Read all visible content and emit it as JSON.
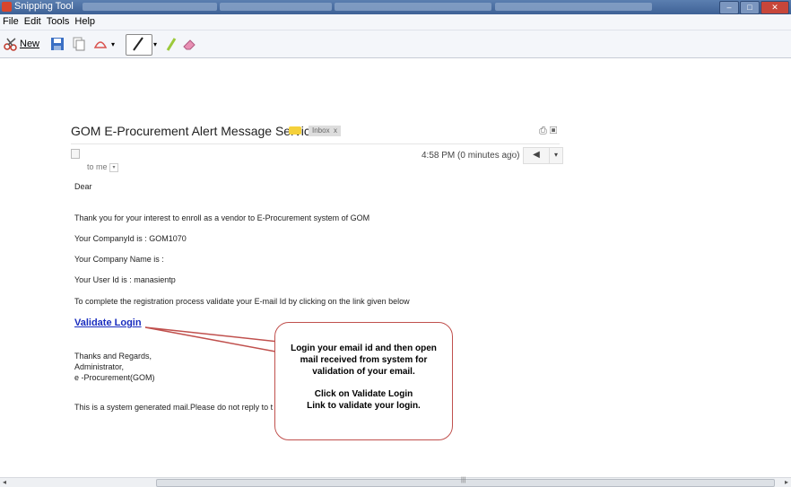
{
  "window": {
    "title": "Snipping Tool"
  },
  "menu": [
    "File",
    "Edit",
    "Tools",
    "Help"
  ],
  "toolbar": {
    "new_label": "New"
  },
  "email": {
    "subject": "GOM E-Procurement Alert Message Service!!",
    "inbox_label": "Inbox",
    "inbox_close": "x",
    "time": "4:58 PM (0 minutes ago)",
    "to_me": "to me",
    "greeting": "Dear",
    "line1": "Thank you for your interest to enroll as a vendor to E-Procurement system of GOM",
    "line2": "Your CompanyId is : GOM1070",
    "line3": "Your Company Name is :",
    "line4": "Your User Id is : manasientp",
    "line5": "To complete the registration process validate your E-mail Id by clicking on the link given below",
    "link": "Validate Login",
    "sign1": "Thanks and Regards,",
    "sign2": "Administrator,",
    "sign3": "e -Procurement(GOM)",
    "footer": "This is a system generated mail.Please do not reply to t"
  },
  "callout": {
    "p1a": "Login your email id and then open",
    "p1b": "mail received from system for",
    "p1c": "validation of your email.",
    "p2a": "Click on Validate Login",
    "p2b": "Link to validate your login."
  },
  "colors": {
    "link": "#1a2dbf",
    "callout_border": "#c0504d",
    "label_chip": "#f5d13b"
  }
}
